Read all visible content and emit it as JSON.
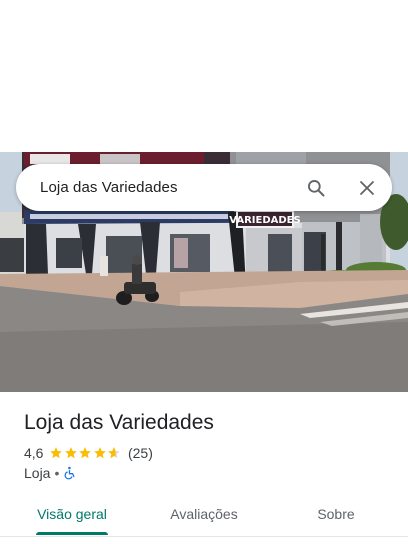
{
  "search": {
    "query": "Loja das Variedades"
  },
  "storefront": {
    "sign_text": "VARIEDADES"
  },
  "place": {
    "title": "Loja das Variedades",
    "rating_value": "4,6",
    "rating_stars": 4.6,
    "review_count": "(25)",
    "category": "Loja",
    "separator": "•"
  },
  "tabs": [
    {
      "label": "Visão geral",
      "active": true
    },
    {
      "label": "Avaliações",
      "active": false
    },
    {
      "label": "Sobre",
      "active": false
    }
  ],
  "colors": {
    "accent": "#00796b",
    "star": "#fbbc04",
    "accessibility": "#1a73e8"
  }
}
